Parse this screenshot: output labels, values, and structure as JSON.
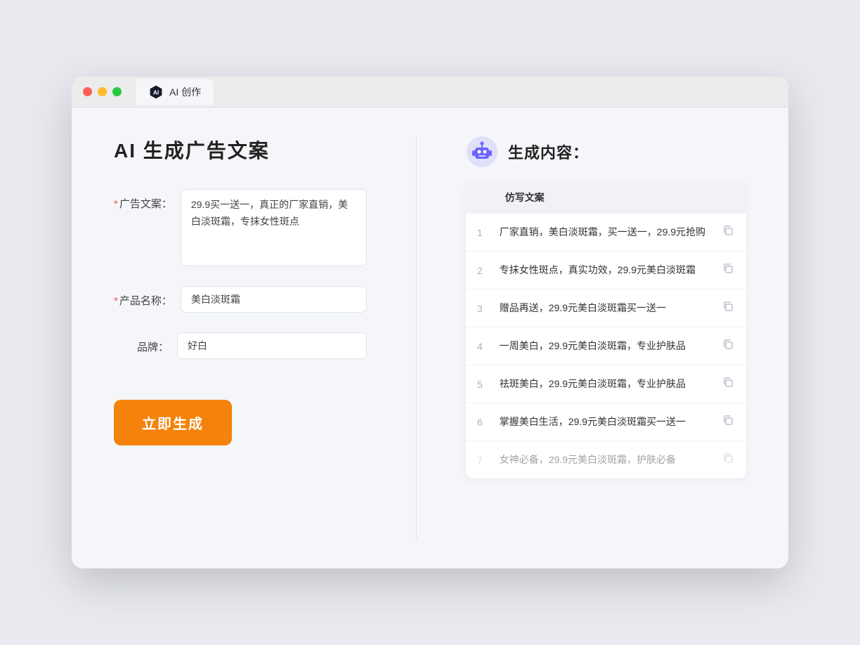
{
  "browser": {
    "tab_label": "AI 创作"
  },
  "left": {
    "title": "AI 生成广告文案",
    "fields": [
      {
        "label": "广告文案：",
        "required": true,
        "type": "textarea",
        "value": "29.9买一送一，真正的厂家直销，美白淡斑霜，专抹女性斑点",
        "name": "ad-copy-textarea"
      },
      {
        "label": "产品名称：",
        "required": true,
        "type": "input",
        "value": "美白淡斑霜",
        "name": "product-name-input"
      },
      {
        "label": "品牌：",
        "required": false,
        "type": "input",
        "value": "好白",
        "name": "brand-input"
      }
    ],
    "button_label": "立即生成"
  },
  "right": {
    "title": "生成内容：",
    "table_header": "仿写文案",
    "rows": [
      {
        "num": "1",
        "text": "厂家直销，美白淡斑霜，买一送一，29.9元抢购",
        "faded": false
      },
      {
        "num": "2",
        "text": "专抹女性斑点，真实功效，29.9元美白淡斑霜",
        "faded": false
      },
      {
        "num": "3",
        "text": "赠品再送，29.9元美白淡斑霜买一送一",
        "faded": false
      },
      {
        "num": "4",
        "text": "一周美白，29.9元美白淡斑霜，专业护肤品",
        "faded": false
      },
      {
        "num": "5",
        "text": "祛斑美白，29.9元美白淡斑霜，专业护肤品",
        "faded": false
      },
      {
        "num": "6",
        "text": "掌握美白生活，29.9元美白淡斑霜买一送一",
        "faded": false
      },
      {
        "num": "7",
        "text": "女神必备，29.9元美白淡斑霜，护肤必备",
        "faded": true
      }
    ]
  }
}
